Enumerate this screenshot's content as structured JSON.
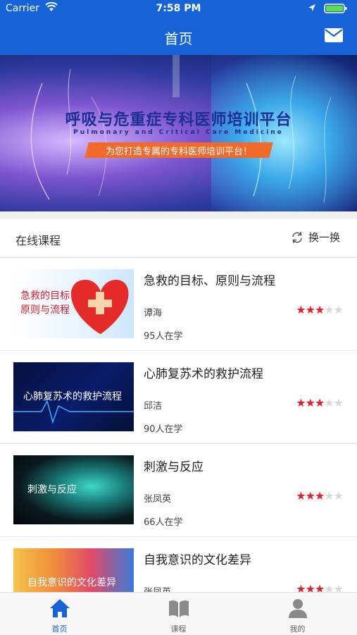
{
  "status": {
    "carrier": "Carrier",
    "time": "7:58 PM"
  },
  "nav": {
    "title": "首页"
  },
  "banner": {
    "title": "呼吸与危重症专科医师培训平台",
    "subtitle": "Pulmonary and Critical Care Medicine",
    "tagline": "为您打造专属的专科医师培训平台！"
  },
  "section": {
    "title": "在线课程",
    "refresh_label": "换一换"
  },
  "courses": [
    {
      "title": "急救的目标、原则与流程",
      "thumb_text": "急救的目标\n原则与流程",
      "teacher": "谭海",
      "learners": "95人在学",
      "rating": 3
    },
    {
      "title": "心肺复苏术的救护流程",
      "thumb_text": "心肺复苏术的救护流程",
      "teacher": "邱洁",
      "learners": "90人在学",
      "rating": 3
    },
    {
      "title": "刺激与反应",
      "thumb_text": "刺激与反应",
      "teacher": "张凤英",
      "learners": "66人在学",
      "rating": 3
    },
    {
      "title": "自我意识的文化差异",
      "thumb_text": "自我意识的文化差异",
      "teacher": "张凤英",
      "learners": "",
      "rating": 3
    }
  ],
  "tabs": [
    {
      "label": "首页",
      "icon": "home-icon",
      "active": true
    },
    {
      "label": "课程",
      "icon": "book-icon",
      "active": false
    },
    {
      "label": "我的",
      "icon": "user-icon",
      "active": false
    }
  ],
  "colors": {
    "primary": "#1563d6",
    "star": "#e0202b",
    "tag": "#f06a2c"
  }
}
